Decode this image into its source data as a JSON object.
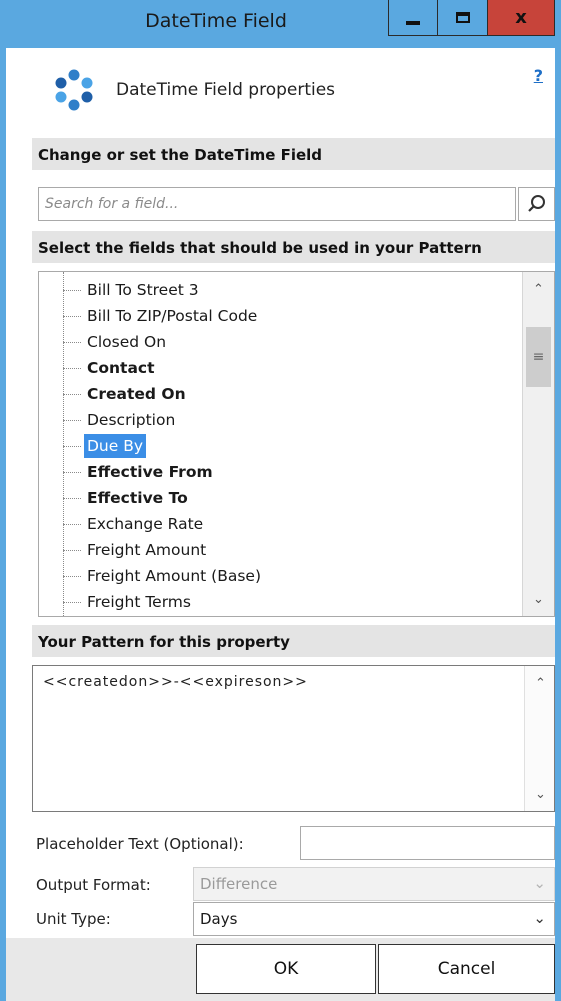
{
  "window": {
    "title": "DateTime Field",
    "minimize_icon": "minimize-icon",
    "maximize_icon": "maximize-icon",
    "close_label": "x"
  },
  "header": {
    "title": "DateTime Field properties",
    "help": "?",
    "logo_icon": "app-logo-icon"
  },
  "field_section": {
    "heading": "Change or set the DateTime Field",
    "search_placeholder": "Search for a field...",
    "search_icon": "search-icon"
  },
  "fields_section": {
    "heading": "Select the fields that should be used in your Pattern",
    "items": [
      {
        "label": "Bill To Street 3",
        "bold": false,
        "selected": false
      },
      {
        "label": "Bill To ZIP/Postal Code",
        "bold": false,
        "selected": false
      },
      {
        "label": "Closed On",
        "bold": false,
        "selected": false
      },
      {
        "label": "Contact",
        "bold": true,
        "selected": false
      },
      {
        "label": "Created On",
        "bold": true,
        "selected": false
      },
      {
        "label": "Description",
        "bold": false,
        "selected": false
      },
      {
        "label": "Due By",
        "bold": false,
        "selected": true
      },
      {
        "label": "Effective From",
        "bold": true,
        "selected": false
      },
      {
        "label": "Effective To",
        "bold": true,
        "selected": false
      },
      {
        "label": "Exchange Rate",
        "bold": false,
        "selected": false
      },
      {
        "label": "Freight Amount",
        "bold": false,
        "selected": false
      },
      {
        "label": "Freight Amount (Base)",
        "bold": false,
        "selected": false
      },
      {
        "label": "Freight Terms",
        "bold": false,
        "selected": false
      }
    ]
  },
  "pattern_section": {
    "heading": "Your Pattern for this property",
    "value": "<<createdon>>-<<expireson>>"
  },
  "form": {
    "placeholder_label": "Placeholder Text (Optional):",
    "placeholder_value": "",
    "output_format_label": "Output Format:",
    "output_format_value": "Difference",
    "unit_type_label": "Unit Type:",
    "unit_type_value": "Days"
  },
  "buttons": {
    "ok": "OK",
    "cancel": "Cancel"
  },
  "colors": {
    "title_bar": "#5aa8e0",
    "close_button": "#c7443a",
    "selection": "#3b8ee6",
    "section_bar": "#e4e4e4"
  }
}
